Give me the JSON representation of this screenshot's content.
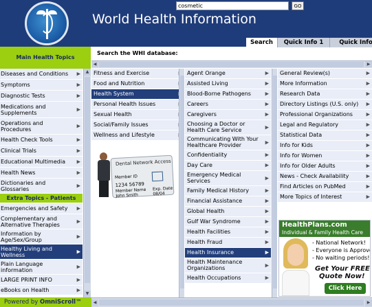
{
  "header": {
    "title": "World Health Information",
    "logo_icon": "caduceus-globe-icon"
  },
  "tabs": [
    {
      "label": "Search"
    },
    {
      "label": "Quick Info 1"
    },
    {
      "label": "Quick Info"
    }
  ],
  "search": {
    "label": "Search the WHI database:",
    "value": "cosmetic",
    "go_label": "GO"
  },
  "left_panel": {
    "heading": "Main Health Topics",
    "items": [
      "Diseases and Conditions",
      "Symptoms",
      "Diagnostic Tests",
      "Medications and Supplements",
      "Operations and Procedures",
      "Health Check Tools",
      "Clinical Trials",
      "Educational Multimedia",
      "Health News",
      "Dictionaries and Glossaries"
    ],
    "extra_heading": "Extra Topics - Patients",
    "extra_items": [
      "Emergencies and Safety",
      "Complementary and Alternative Therapies",
      "Information by Age/Sex/Group",
      "Healthy Living and Wellness",
      "Plain Language information",
      "LARGE PRINT INFO",
      "eBooks on Health"
    ],
    "selected": "Healthy Living and Wellness"
  },
  "col1": {
    "items": [
      "Fitness and Exercise",
      "Food and Nutrition",
      "Health System",
      "Personal Health Issues",
      "Sexual Health",
      "Social/Family Issues",
      "Wellness and Lifestyle"
    ],
    "selected": "Health System"
  },
  "col2": {
    "items": [
      "Agent Orange",
      "Assisted Living",
      "Blood-Borne Pathogens",
      "Careers",
      "Caregivers",
      "Choosing a Doctor or Health Care Service",
      "Communicating With Your Healthcare Provider",
      "Confidentiality",
      "Day Care",
      "Emergency Medical Services",
      "Family Medical History",
      "Financial Assistance",
      "Global Health",
      "Gulf War Syndrome",
      "Health Facilities",
      "Health Fraud",
      "Health Insurance",
      "Health Maintenance Organizations",
      "Health Occupations"
    ],
    "selected": "Health Insurance"
  },
  "col3": {
    "items": [
      "General Review(s)",
      "More Information",
      "Research Data",
      "Directory Listings (U.S. only)",
      "Professional Organizations",
      "Legal and Regulatory",
      "Statistical Data",
      "Info for Kids",
      "Info for Women",
      "Info for Older Adults",
      "News - Check Availability",
      "Find Articles on PubMed",
      "More Topics of Interest"
    ]
  },
  "card": {
    "title": "Dental Network Access",
    "member_label": "Member ID",
    "member_id": "1234  56789",
    "name_label": "Member Name",
    "name": "John Smith",
    "exp_label": "Exp. Date",
    "exp": "08/04"
  },
  "ad": {
    "brand": "HealthPlans.com",
    "subtitle": "Individual & Family Health Care",
    "bullets": [
      "- National Network!",
      "- Everyone is Approved!",
      "- No waiting periods!"
    ],
    "quote_line1": "Get Your FREE",
    "quote_line2": "Quote Now!",
    "button": "Click Here"
  },
  "footer": {
    "prefix": "Powered by ",
    "brand": "OmniScroll™"
  },
  "colors": {
    "header": "#1f3c7a",
    "green": "#9bcf0f",
    "selected": "#233f7b",
    "row": "#e8edf7"
  }
}
